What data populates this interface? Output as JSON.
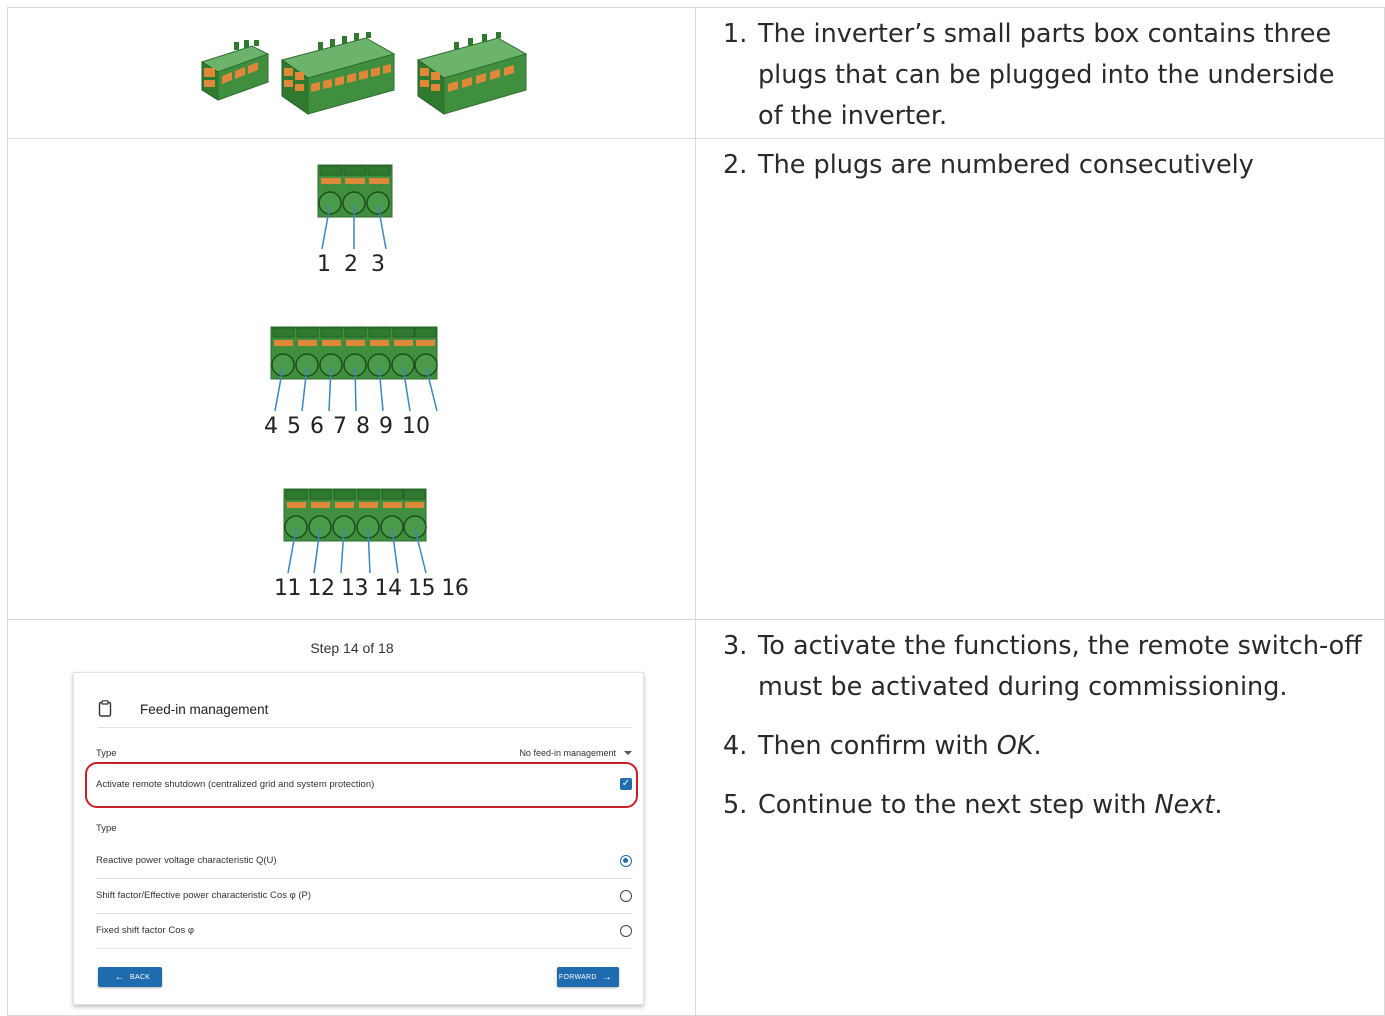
{
  "rows": [
    {
      "steps": [
        {
          "num": "1.",
          "text": "The inverter’s small parts box contains three plugs that can be plugged into the underside of the inverter."
        }
      ]
    },
    {
      "steps": [
        {
          "num": "2.",
          "text": "The plugs are numbered consecutively"
        }
      ],
      "plug_labels": {
        "plug1": "1  2  3",
        "plug2": "4  5  6  7  8  9 10",
        "plug3": "11 12 13 14 15 16"
      }
    },
    {
      "steps": [
        {
          "num": "3.",
          "text": "To activate the functions, the remote switch-off must be activated during commissioning."
        },
        {
          "num": "4.",
          "pre": "Then confirm with ",
          "em": "OK",
          "post": "."
        },
        {
          "num": "5.",
          "pre": "Continue to the next step with ",
          "em": "Next",
          "post": "."
        }
      ]
    }
  ],
  "screenshot": {
    "step_caption": "Step 14 of 18",
    "title": "Feed-in management",
    "type_label": "Type",
    "type_value": "No feed-in management",
    "remote_shutdown_label": "Activate remote shutdown (centralized grid and system protection)",
    "type2_label": "Type",
    "options": [
      {
        "label": "Reactive power voltage characteristic Q(U)",
        "selected": true
      },
      {
        "label": "Shift factor/Effective power characteristic Cos φ (P)",
        "selected": false
      },
      {
        "label": "Fixed shift factor Cos φ",
        "selected": false
      }
    ],
    "back_label": "BACK",
    "forward_label": "FORWARD"
  },
  "colors": {
    "plug_green": "#3f8f3f",
    "plug_orange": "#e0883a",
    "accent_blue": "#1e6bb0",
    "highlight_red": "#c8202a"
  }
}
